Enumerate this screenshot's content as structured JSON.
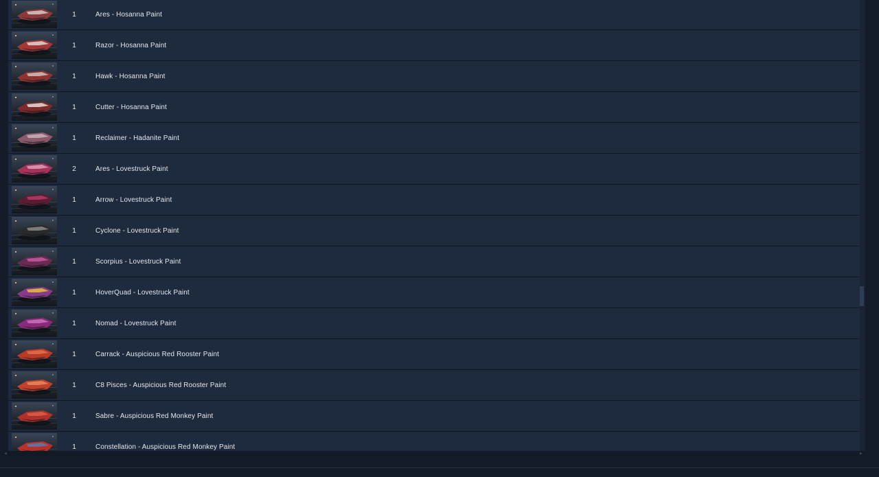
{
  "items": [
    {
      "qty": "1",
      "name": "Ares - Hosanna Paint",
      "colors": [
        "#8a3a3a",
        "#d8c9c6"
      ]
    },
    {
      "qty": "1",
      "name": "Razor - Hosanna Paint",
      "colors": [
        "#a43838",
        "#e2d6d2"
      ]
    },
    {
      "qty": "1",
      "name": "Hawk - Hosanna Paint",
      "colors": [
        "#8e3232",
        "#cfc2bd"
      ]
    },
    {
      "qty": "1",
      "name": "Cutter - Hosanna Paint",
      "colors": [
        "#7c2a2a",
        "#e5ded8"
      ]
    },
    {
      "qty": "1",
      "name": "Reclaimer - Hadanite Paint",
      "colors": [
        "#8a5a6a",
        "#c8b2ba"
      ]
    },
    {
      "qty": "2",
      "name": "Ares - Lovestruck Paint",
      "colors": [
        "#a8325a",
        "#d9a0b8"
      ]
    },
    {
      "qty": "1",
      "name": "Arrow - Lovestruck Paint",
      "colors": [
        "#5a1e34",
        "#b83a6a"
      ]
    },
    {
      "qty": "1",
      "name": "Cyclone - Lovestruck Paint",
      "colors": [
        "#2a2a2a",
        "#8a8a8a"
      ]
    },
    {
      "qty": "1",
      "name": "Scorpius - Lovestruck Paint",
      "colors": [
        "#6a2a52",
        "#c45aa0"
      ]
    },
    {
      "qty": "1",
      "name": "HoverQuad - Lovestruck Paint",
      "colors": [
        "#8a3a8a",
        "#e0c23a"
      ]
    },
    {
      "qty": "1",
      "name": "Nomad - Lovestruck Paint",
      "colors": [
        "#8a2a7a",
        "#d070c0"
      ]
    },
    {
      "qty": "1",
      "name": "Carrack - Auspicious Red Rooster Paint",
      "colors": [
        "#b83a2a",
        "#e0704a"
      ]
    },
    {
      "qty": "1",
      "name": "C8 Pisces - Auspicious Red Rooster Paint",
      "colors": [
        "#c2402e",
        "#e88a5a"
      ]
    },
    {
      "qty": "1",
      "name": "Sabre - Auspicious Red Monkey Paint",
      "colors": [
        "#b0302a",
        "#d8604a"
      ]
    },
    {
      "qty": "1",
      "name": "Constellation - Auspicious Red Monkey Paint",
      "colors": [
        "#b83028",
        "#5a7ab0"
      ]
    }
  ],
  "colors": {
    "background": "#141c29",
    "panel": "#1e2a3e",
    "row_divider": "#0f1624",
    "text": "#e4e8ee"
  }
}
